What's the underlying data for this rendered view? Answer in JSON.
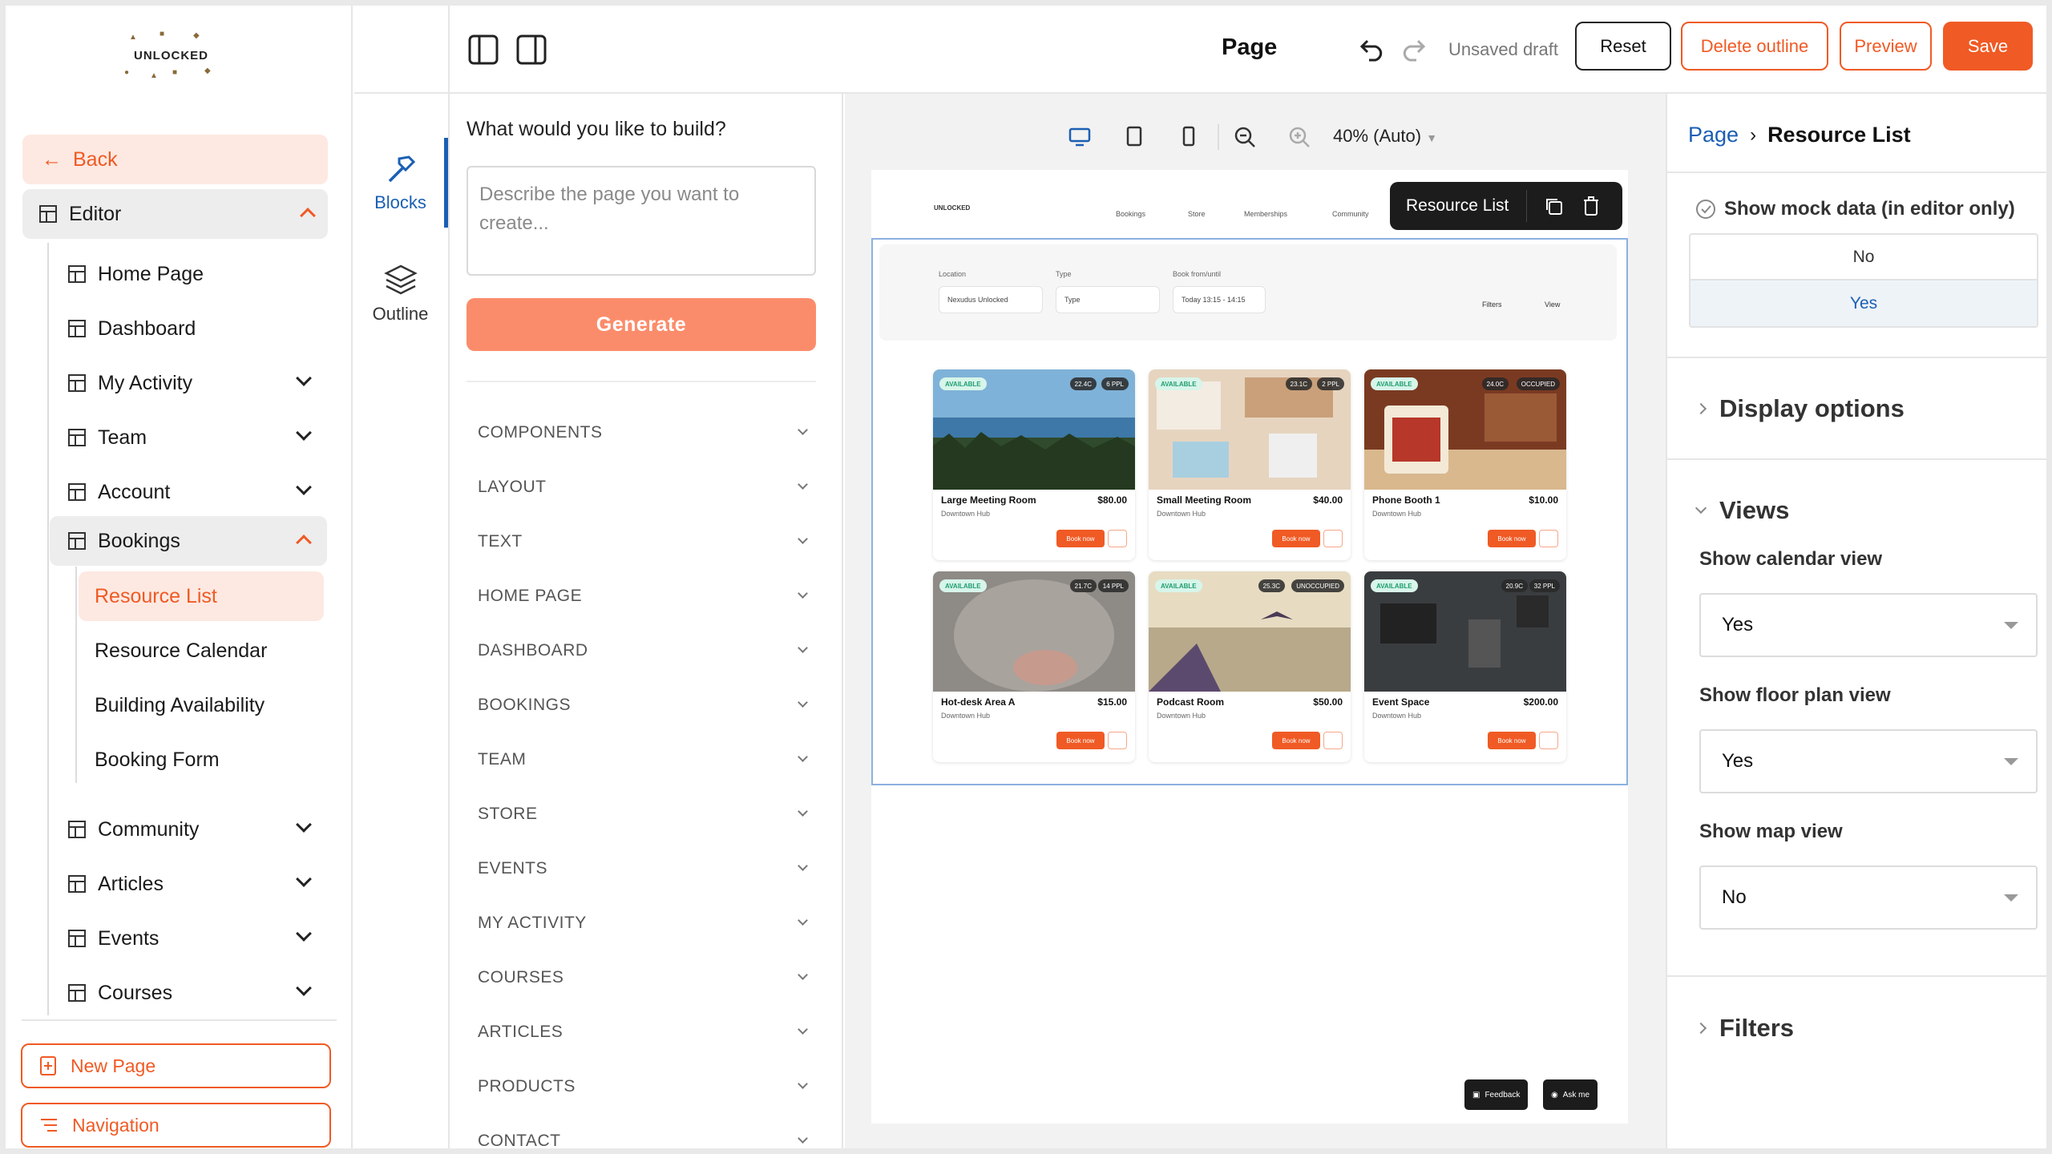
{
  "brand": {
    "logo_text": "UNLOCKED",
    "accent": "#f05a24",
    "link_blue": "#1b5fb4"
  },
  "sidebar": {
    "back": "Back",
    "editor": "Editor",
    "items": [
      {
        "label": "Home Page"
      },
      {
        "label": "Dashboard"
      },
      {
        "label": "My Activity"
      },
      {
        "label": "Team"
      },
      {
        "label": "Account"
      },
      {
        "label": "Bookings"
      },
      {
        "label": "Community"
      },
      {
        "label": "Articles"
      },
      {
        "label": "Events"
      },
      {
        "label": "Courses"
      }
    ],
    "booking_children": [
      "Resource List",
      "Resource Calendar",
      "Building Availability",
      "Booking Form"
    ],
    "new_page": "New Page",
    "navigation": "Navigation"
  },
  "rail": {
    "blocks": "Blocks",
    "outline": "Outline"
  },
  "blocks_panel": {
    "question": "What would you like to build?",
    "placeholder": "Describe the page you want to create...",
    "generate": "Generate",
    "categories": [
      "COMPONENTS",
      "LAYOUT",
      "TEXT",
      "HOME PAGE",
      "DASHBOARD",
      "BOOKINGS",
      "TEAM",
      "STORE",
      "EVENTS",
      "MY ACTIVITY",
      "COURSES",
      "ARTICLES",
      "PRODUCTS",
      "CONTACT"
    ]
  },
  "topbar": {
    "title": "Page",
    "status": "Unsaved draft",
    "reset": "Reset",
    "delete_outline": "Delete outline",
    "preview": "Preview",
    "save": "Save"
  },
  "canvas": {
    "zoom": "40% (Auto)",
    "selected_chip": "Resource List",
    "site_nav": [
      "Bookings",
      "Store",
      "Memberships",
      "Community"
    ],
    "filters": {
      "location_label": "Location",
      "location_value": "Nexudus Unlocked",
      "type_label": "Type",
      "type_value": "Type",
      "book_label": "Book from/until",
      "book_value": "Today 13:15 - 14:15",
      "filters_btn": "Filters",
      "view_btn": "View"
    },
    "cards": [
      {
        "name": "Large Meeting Room",
        "price": "$80.00",
        "loc": "Downtown Hub",
        "status": "AVAILABLE",
        "temp": "22.4C",
        "ppl": "6 PPL"
      },
      {
        "name": "Small Meeting Room",
        "price": "$40.00",
        "loc": "Downtown Hub",
        "status": "AVAILABLE",
        "temp": "23.1C",
        "ppl": "2 PPL"
      },
      {
        "name": "Phone Booth 1",
        "price": "$10.00",
        "loc": "Downtown Hub",
        "status": "AVAILABLE",
        "temp": "24.0C",
        "ppl": "OCCUPIED"
      },
      {
        "name": "Hot-desk Area A",
        "price": "$15.00",
        "loc": "Downtown Hub",
        "status": "AVAILABLE",
        "temp": "21.7C",
        "ppl": "14 PPL"
      },
      {
        "name": "Podcast Room",
        "price": "$50.00",
        "loc": "Downtown Hub",
        "status": "AVAILABLE",
        "temp": "25.3C",
        "ppl": "UNOCCUPIED"
      },
      {
        "name": "Event Space",
        "price": "$200.00",
        "loc": "Downtown Hub",
        "status": "AVAILABLE",
        "temp": "20.9C",
        "ppl": "32 PPL"
      }
    ],
    "book_now": "Book now",
    "feedback": "Feedback",
    "ask_me": "Ask me"
  },
  "props": {
    "breadcrumb_root": "Page",
    "breadcrumb_current": "Resource List",
    "mock_label": "Show mock data (in editor only)",
    "mock_options": [
      "No",
      "Yes"
    ],
    "display_options": "Display options",
    "views": "Views",
    "calendar_label": "Show calendar view",
    "calendar_value": "Yes",
    "floor_label": "Show floor plan view",
    "floor_value": "Yes",
    "map_label": "Show map view",
    "map_value": "No",
    "filters": "Filters"
  }
}
